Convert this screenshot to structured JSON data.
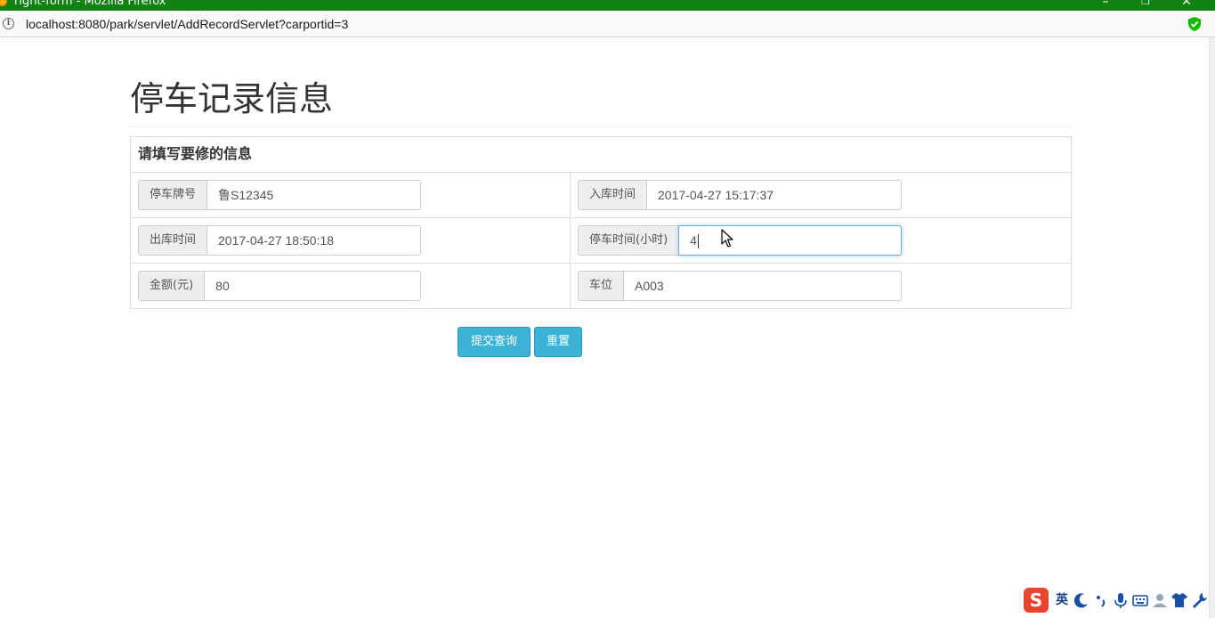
{
  "window": {
    "title": "right-form - Mozilla Firefox",
    "minimize": "–",
    "restore": "❐",
    "close": "✕"
  },
  "browser": {
    "url": "localhost:8080/park/servlet/AddRecordServlet?carportid=3"
  },
  "page": {
    "title": "停车记录信息",
    "panel_heading": "请填写要修的信息"
  },
  "form": {
    "plate": {
      "label": "停车牌号",
      "value": "鲁S12345"
    },
    "entry_time": {
      "label": "入库时间",
      "value": "2017-04-27 15:17:37"
    },
    "exit_time": {
      "label": "出库时间",
      "value": "2017-04-27 18:50:18"
    },
    "duration": {
      "label": "停车时间(小时)",
      "value": "4"
    },
    "amount": {
      "label": "金额(元)",
      "value": "80"
    },
    "space": {
      "label": "车位",
      "value": "A003"
    }
  },
  "buttons": {
    "submit": "提交查询",
    "reset": "重置"
  },
  "ime": {
    "logo": "S",
    "mode": "英",
    "items": [
      "moon-icon",
      "punctuation-icon",
      "microphone-icon",
      "keyboard-icon",
      "user-icon",
      "skin-icon",
      "wrench-icon"
    ]
  },
  "colors": {
    "titlebar": "#128212",
    "button": "#3bb3d6",
    "focus_border": "#66afe9"
  }
}
